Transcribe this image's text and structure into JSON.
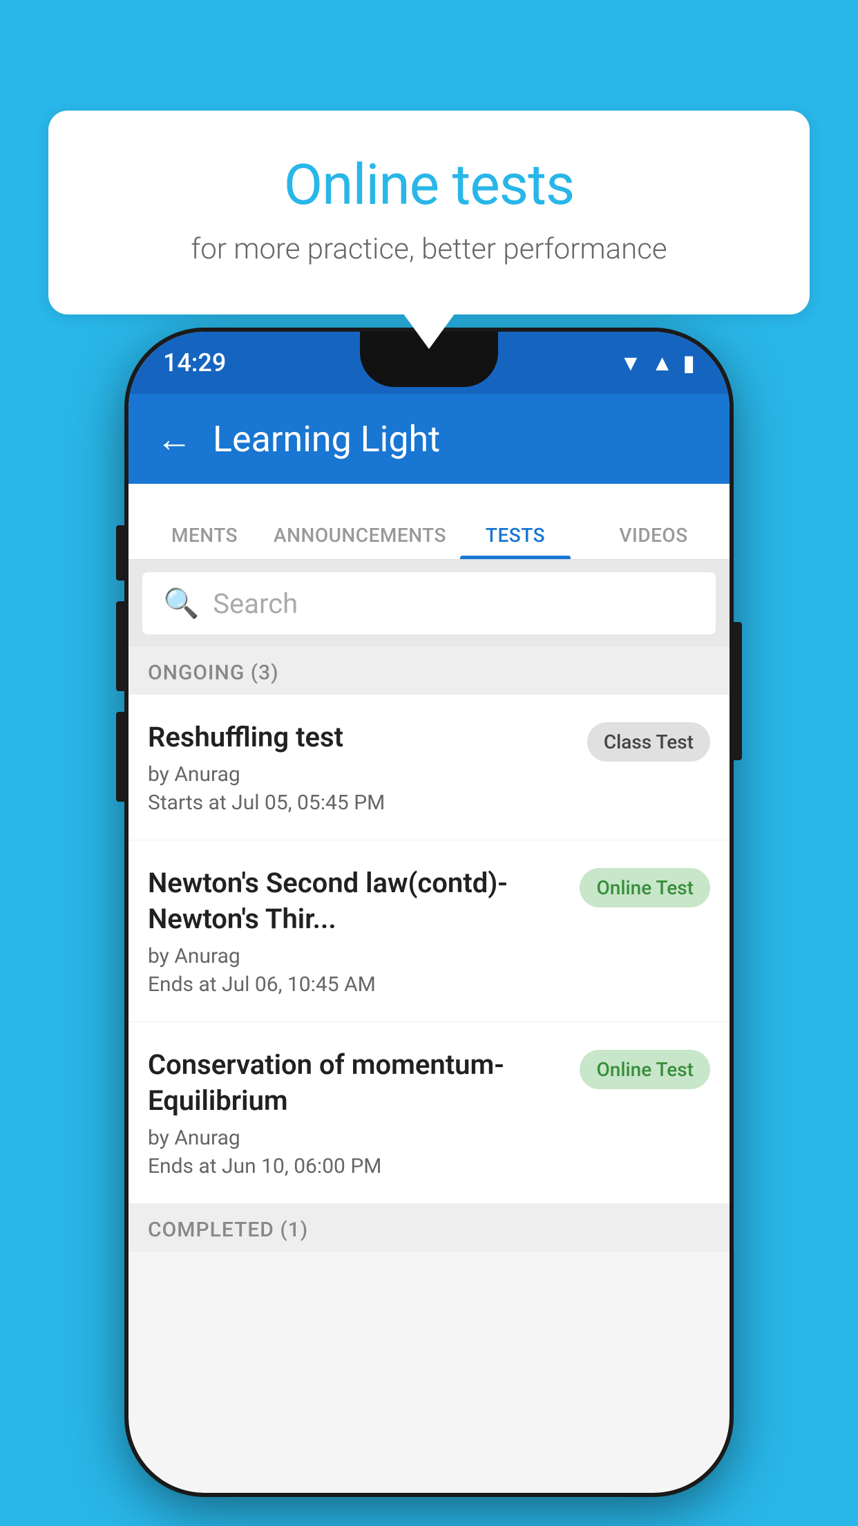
{
  "background": {
    "color": "#29B6E8"
  },
  "speech_bubble": {
    "title": "Online tests",
    "subtitle": "for more practice, better performance"
  },
  "phone": {
    "status_bar": {
      "time": "14:29",
      "icons": [
        "wifi",
        "signal",
        "battery"
      ]
    },
    "app_bar": {
      "title": "Learning Light",
      "back_label": "←"
    },
    "tabs": [
      {
        "label": "MENTS",
        "active": false
      },
      {
        "label": "ANNOUNCEMENTS",
        "active": false
      },
      {
        "label": "TESTS",
        "active": true
      },
      {
        "label": "VIDEOS",
        "active": false
      }
    ],
    "search": {
      "placeholder": "Search"
    },
    "sections": [
      {
        "label": "ONGOING (3)",
        "tests": [
          {
            "name": "Reshuffling test",
            "by": "by Anurag",
            "time": "Starts at  Jul 05, 05:45 PM",
            "badge": "Class Test",
            "badge_type": "class"
          },
          {
            "name": "Newton's Second law(contd)-Newton's Thir...",
            "by": "by Anurag",
            "time": "Ends at  Jul 06, 10:45 AM",
            "badge": "Online Test",
            "badge_type": "online"
          },
          {
            "name": "Conservation of momentum-Equilibrium",
            "by": "by Anurag",
            "time": "Ends at  Jun 10, 06:00 PM",
            "badge": "Online Test",
            "badge_type": "online"
          }
        ]
      }
    ],
    "completed_section": {
      "label": "COMPLETED (1)"
    }
  }
}
